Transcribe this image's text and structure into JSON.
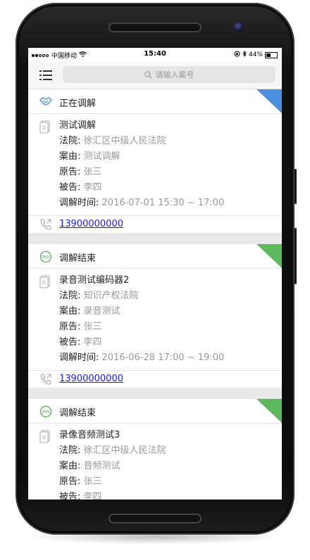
{
  "statusbar": {
    "carrier": "中国移动",
    "time": "15:40",
    "battery": "44%",
    "battery_level": 0.44
  },
  "search": {
    "placeholder": "请输入案号"
  },
  "cases": [
    {
      "status": "正在调解",
      "status_color": "#4a8fe0",
      "corner_color": "#4a8fe0",
      "status_icon": "handshake-icon",
      "title": "测试调解",
      "court_label": "法院:",
      "court": "徐汇区中级人民法院",
      "cause_label": "案由:",
      "cause": "测试调解",
      "plaintiff_label": "原告:",
      "plaintiff": "张三",
      "defendant_label": "被告:",
      "defendant": "李四",
      "time_label": "调解时间:",
      "time": "2016-07-01 15:30 ~ 17:00",
      "phone": "13900000000"
    },
    {
      "status": "调解结束",
      "status_color": "#4bb354",
      "corner_color": "#5cb85c",
      "status_icon": "end-icon",
      "status_icon_text": "END",
      "title": "录音测试编码器2",
      "court_label": "法院:",
      "court": "知识产权法院",
      "cause_label": "案由:",
      "cause": "录音测试",
      "plaintiff_label": "原告:",
      "plaintiff": "张三",
      "defendant_label": "被告:",
      "defendant": "李四",
      "time_label": "调解时间:",
      "time": "2016-06-28 17:00 ~ 19:00",
      "phone": "13900000000"
    },
    {
      "status": "调解结束",
      "status_color": "#4bb354",
      "corner_color": "#5cb85c",
      "status_icon": "end-icon",
      "status_icon_text": "END",
      "title": "录像音频测试3",
      "court_label": "法院:",
      "court": "徐汇区中级人民法院",
      "cause_label": "案由:",
      "cause": "音频测试",
      "plaintiff_label": "原告:",
      "plaintiff": "张三",
      "defendant_label": "被告:",
      "defendant": "李四"
    }
  ]
}
